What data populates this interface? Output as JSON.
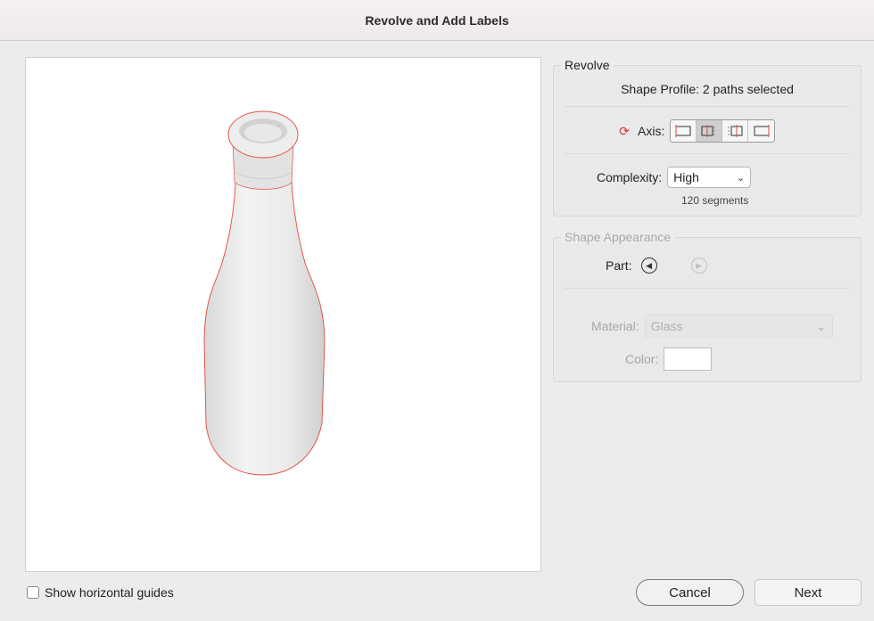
{
  "window": {
    "title": "Revolve and Add Labels"
  },
  "preview": {
    "guides_label": "Show horizontal guides",
    "guides_checked": false
  },
  "revolve": {
    "legend": "Revolve",
    "profile_text": "Shape Profile: 2 paths selected",
    "axis_label": "Axis:",
    "axis_icon": "rotate-axis-icon",
    "axis_options": [
      "axis-left-edge",
      "axis-left-center",
      "axis-right-center",
      "axis-right-edge"
    ],
    "axis_selected_index": 1,
    "complexity_label": "Complexity:",
    "complexity_value": "High",
    "segments_text": "120 segments"
  },
  "appearance": {
    "legend": "Shape Appearance",
    "part_label": "Part:",
    "material_label": "Material:",
    "material_value": "Glass",
    "color_label": "Color:",
    "color_value": "#ffffff"
  },
  "buttons": {
    "cancel": "Cancel",
    "next": "Next"
  },
  "colors": {
    "outline": "#e24a3b",
    "accent_selected": "#cfcfcf"
  }
}
